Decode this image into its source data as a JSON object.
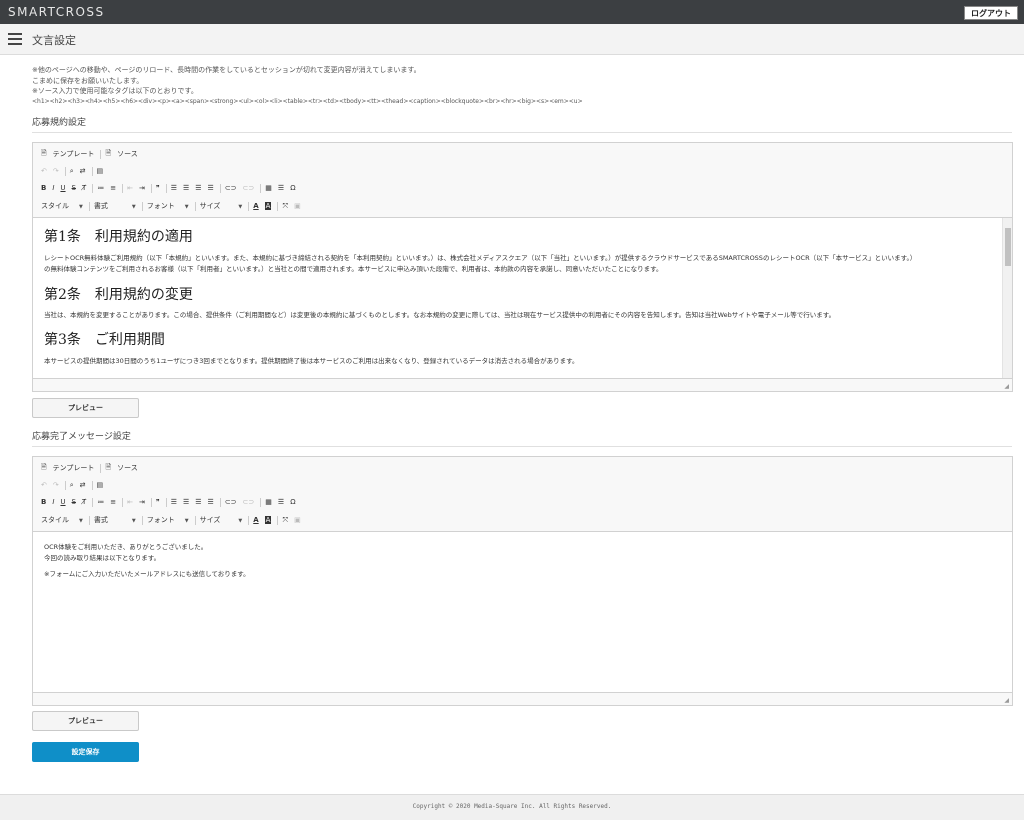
{
  "header": {
    "logo": "SMARTCROSS",
    "logout_label": "ログアウト"
  },
  "subheader": {
    "title": "文言設定"
  },
  "notes": [
    "※他のページへの移動や、ページのリロード、長時間の作業をしているとセッションが切れて変更内容が消えてしまいます。",
    "こまめに保存をお願いいたします。",
    "※ソース入力で使用可能なタグは以下のとおりです。",
    "<h1><h2><h3><h4><h5><h6><div><p><a><span><strong><ul><ol><li><table><tr><td><tbody><tt><thead><caption><blockquote><br><hr><big><s><em><u>"
  ],
  "toolbar": {
    "template": "テンプレート",
    "source": "ソース",
    "style": "スタイル",
    "format": "書式",
    "font": "フォント",
    "size": "サイズ",
    "bold": "B",
    "italic": "I",
    "underline": "U",
    "strike": "S",
    "quote": "❞",
    "omega": "Ω",
    "textcolor": "A",
    "bgcolor": "A"
  },
  "section1": {
    "title": "応募規約設定",
    "headings": [
      "第1条　利用規約の適用",
      "第2条　利用規約の変更",
      "第3条　ご利用期間"
    ],
    "paragraphs": [
      "レシートOCR無料体験ご利用規約（以下「本規約」といいます。また、本規約に基づき締結される契約を「本利用契約」といいます。）は、株式会社メディアスクエア（以下「当社」といいます。）が提供するクラウドサービスであるSMARTCROSSのレシートOCR（以下「本サービス」といいます。）",
      "の無料体験コンテンツをご利用されるお客様（以下「利用者」といいます。）と当社との間で適用されます。本サービスに申込み頂いた段階で、利用者は、本約款の内容を承諾し、同意いただいたことになります。",
      "当社は、本規約を変更することがあります。この場合、提供条件（ご利用期間など）は変更後の本規約に基づくものとします。なお本規約の変更に際しては、当社は現在サービス提供中の利用者にその内容を告知します。告知は当社Webサイトや電子メール等で行います。",
      "本サービスの提供期間は30日間のうち1ユーザにつき3回までとなります。提供期間終了後は本サービスのご利用は出来なくなり、登録されているデータは消去される場合があります。"
    ],
    "preview_label": "プレビュー"
  },
  "section2": {
    "title": "応募完了メッセージ設定",
    "lines": [
      "OCR体験をご利用いただき、ありがとうございました。",
      "今回の読み取り結果は以下となります。",
      "※フォームにご入力いただいたメールアドレスにも送信しております。"
    ],
    "preview_label": "プレビュー"
  },
  "save_label": "設定保存",
  "footer": "Copyright © 2020 Media-Square Inc. All Rights Reserved.",
  "colors": {
    "topbar": "#3c3f42",
    "primary": "#0f8fc8"
  }
}
